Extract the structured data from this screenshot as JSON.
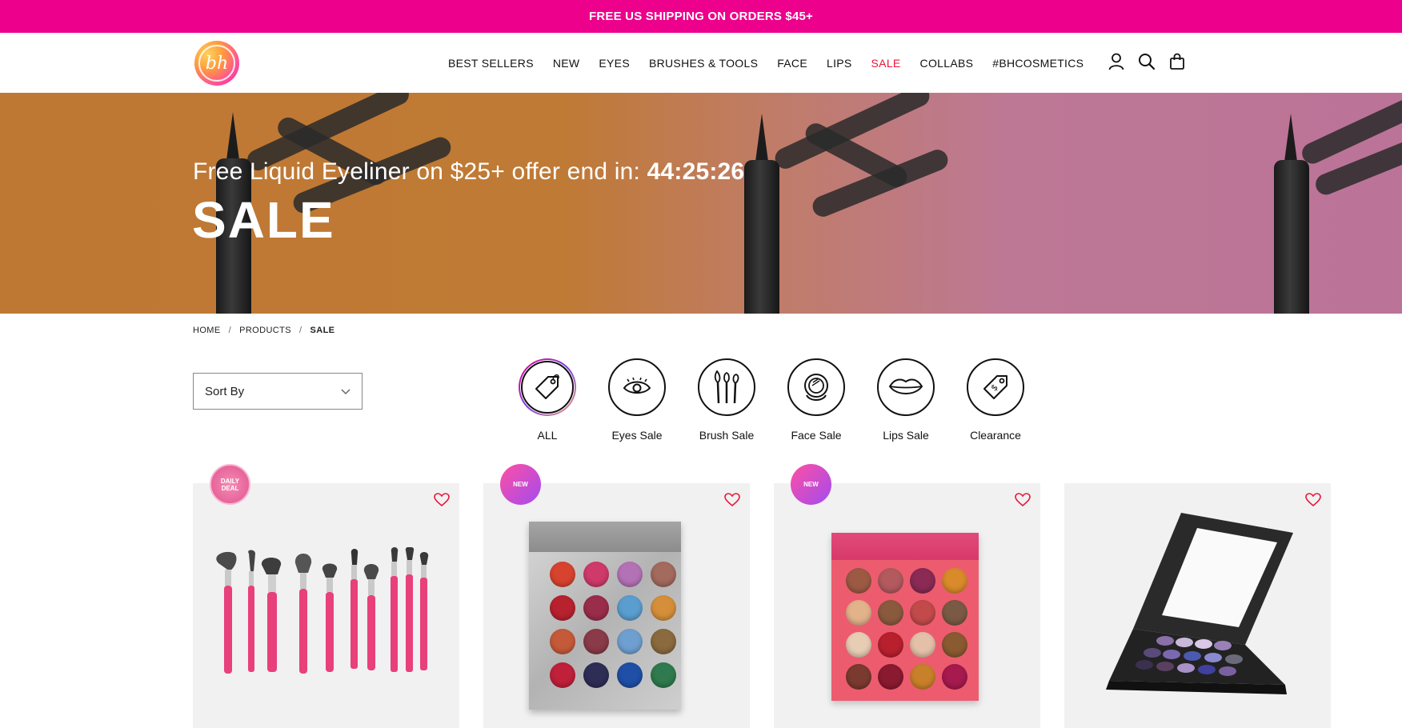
{
  "promo": {
    "text": "FREE US SHIPPING ON ORDERS $45+"
  },
  "header": {
    "logo_text": "bh",
    "nav": [
      "BEST SELLERS",
      "NEW",
      "EYES",
      "BRUSHES & TOOLS",
      "FACE",
      "LIPS",
      "SALE",
      "COLLABS",
      "#BHCOSMETICS"
    ],
    "icons": [
      "account-icon",
      "search-icon",
      "bag-icon"
    ]
  },
  "hero": {
    "subtitle": "Free Liquid Eyeliner on $25+ offer end in:",
    "timer": "44:25:26",
    "title": "SALE"
  },
  "breadcrumb": [
    "HOME",
    "PRODUCTS",
    "SALE"
  ],
  "sort": {
    "label": "Sort By"
  },
  "categories": [
    {
      "label": "ALL",
      "icon": "tag-icon",
      "active": true
    },
    {
      "label": "Eyes Sale",
      "icon": "eye-icon",
      "active": false
    },
    {
      "label": "Brush Sale",
      "icon": "brushes-icon",
      "active": false
    },
    {
      "label": "Face Sale",
      "icon": "compact-icon",
      "active": false
    },
    {
      "label": "Lips Sale",
      "icon": "lips-icon",
      "active": false
    },
    {
      "label": "Clearance",
      "icon": "price-tag-icon",
      "active": false
    }
  ],
  "products": [
    {
      "badge": "DAILY DEAL",
      "art": "pink-brush-set"
    },
    {
      "badge": "NEW",
      "art": "illusion-palette"
    },
    {
      "badge": "NEW",
      "art": "coral-palette"
    },
    {
      "badge": "",
      "art": "black-mirror-palette"
    }
  ],
  "colors": {
    "promo": "#ec008c",
    "sale_nav": "#e8153a",
    "heart": "#e8153a"
  }
}
